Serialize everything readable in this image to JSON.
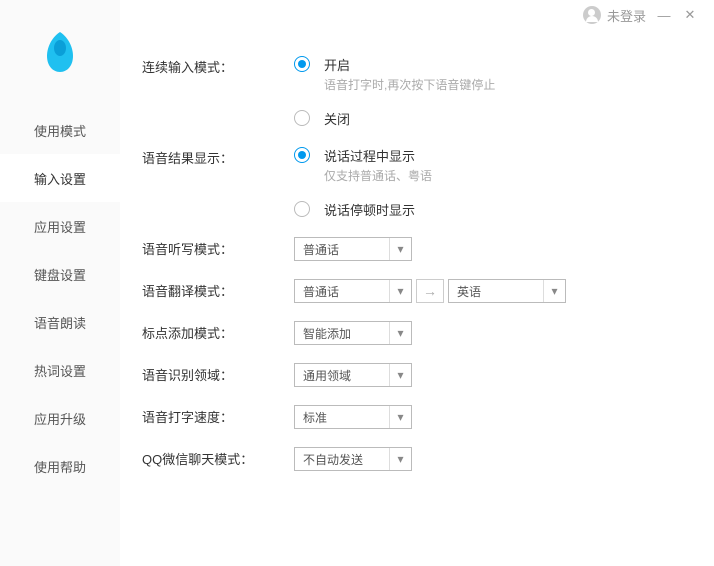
{
  "titlebar": {
    "login_status": "未登录"
  },
  "sidebar": {
    "items": [
      {
        "label": "使用模式"
      },
      {
        "label": "输入设置"
      },
      {
        "label": "应用设置"
      },
      {
        "label": "键盘设置"
      },
      {
        "label": "语音朗读"
      },
      {
        "label": "热词设置"
      },
      {
        "label": "应用升级"
      },
      {
        "label": "使用帮助"
      }
    ]
  },
  "settings": {
    "continuous_input": {
      "label": "连续输入模式：",
      "on_label": "开启",
      "on_sub": "语音打字时,再次按下语音键停止",
      "off_label": "关闭"
    },
    "result_display": {
      "label": "语音结果显示：",
      "during_label": "说话过程中显示",
      "during_sub": "仅支持普通话、粤语",
      "pause_label": "说话停顿时显示"
    },
    "dictation_mode": {
      "label": "语音听写模式：",
      "value": "普通话"
    },
    "translate_mode": {
      "label": "语音翻译模式：",
      "from": "普通话",
      "to": "英语"
    },
    "punctuation": {
      "label": "标点添加模式：",
      "value": "智能添加"
    },
    "domain": {
      "label": "语音识别领域：",
      "value": "通用领域"
    },
    "speed": {
      "label": "语音打字速度：",
      "value": "标准"
    },
    "qq_wechat": {
      "label": "QQ微信聊天模式：",
      "value": "不自动发送"
    }
  }
}
